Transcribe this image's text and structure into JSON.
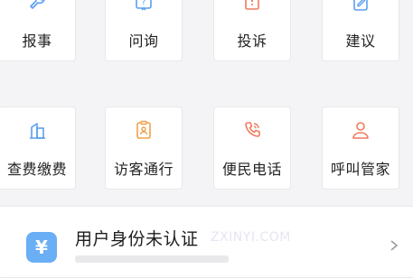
{
  "services": {
    "row1": [
      {
        "label": "报事",
        "icon": "wrench-icon"
      },
      {
        "label": "问询",
        "icon": "question-icon"
      },
      {
        "label": "投诉",
        "icon": "complaint-book-icon"
      },
      {
        "label": "建议",
        "icon": "pencil-note-icon"
      }
    ],
    "row2": [
      {
        "label": "查费缴费",
        "icon": "building-fee-icon"
      },
      {
        "label": "访客通行",
        "icon": "visitor-pass-icon"
      },
      {
        "label": "便民电话",
        "icon": "phone-icon"
      },
      {
        "label": "呼叫管家",
        "icon": "butler-person-icon"
      }
    ]
  },
  "identity_card": {
    "title": "用户身份未认证",
    "watermark": "ZXINYI.COM",
    "icon_symbol": "¥",
    "chevron": "chevron-right-icon"
  },
  "colors": {
    "icon_blue": "#5b9ef0",
    "icon_orange": "#f0a04b",
    "icon_red": "#f07a5e",
    "card_icon_bg": "#6aaef5"
  }
}
